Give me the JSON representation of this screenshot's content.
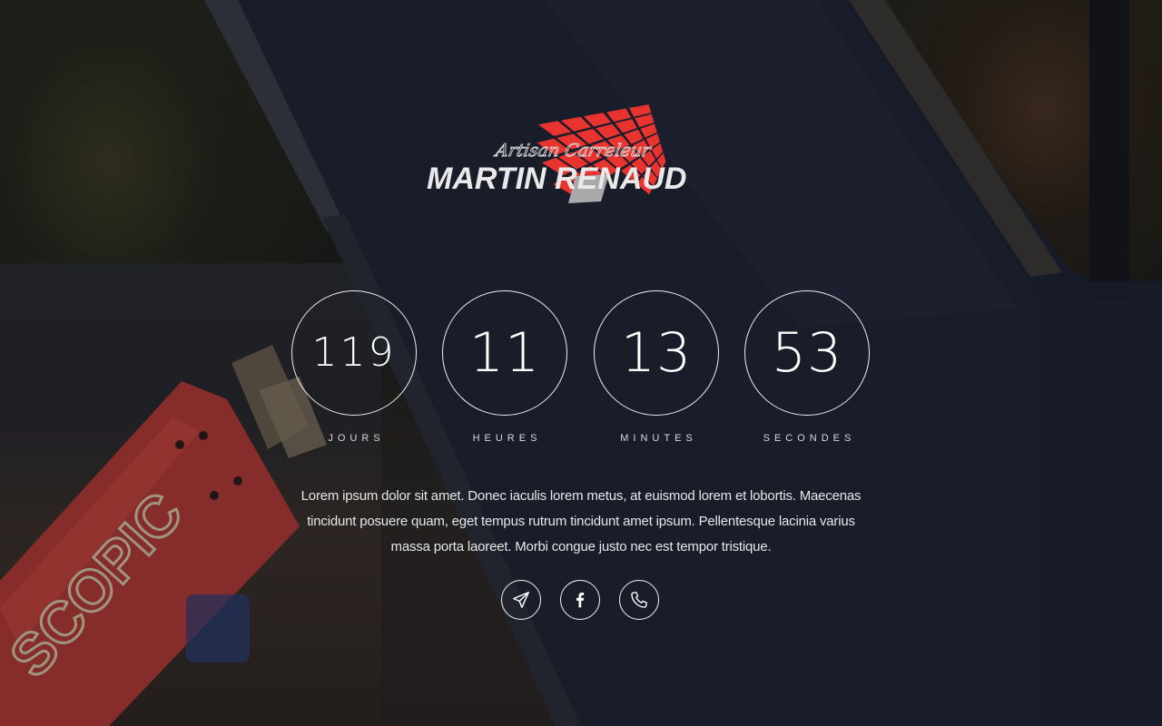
{
  "brand": {
    "script": "Artisan Carreleur",
    "name": "MARTIN RENAUD",
    "colors": {
      "tile_red": "#e8332f",
      "tile_grid": "#2a2a2a",
      "tile_grey": "#a9a9a9",
      "lettering": "#e9e9e9"
    }
  },
  "countdown": {
    "days": {
      "value": "119",
      "label": "JOURS"
    },
    "hours": {
      "value": "11",
      "label": "HEURES"
    },
    "minutes": {
      "value": "13",
      "label": "MINUTES"
    },
    "seconds": {
      "value": "53",
      "label": "SECONDES"
    }
  },
  "description": "Lorem ipsum dolor sit amet. Donec iaculis lorem metus, at euismod lorem et lobortis. Maecenas tincidunt posuere quam, eget tempus rutrum tincidunt amet ipsum. Pellentesque lacinia varius massa porta laoreet. Morbi congue justo nec est tempor tristique.",
  "social": [
    {
      "icon": "paper-plane-icon"
    },
    {
      "icon": "facebook-icon"
    },
    {
      "icon": "phone-icon"
    }
  ],
  "background": {
    "watermark_text": "SCOPIC",
    "colors": {
      "overlay": "#141821",
      "machine_red": "#c9443a",
      "machine_stripe": "#d9c9a8"
    }
  }
}
